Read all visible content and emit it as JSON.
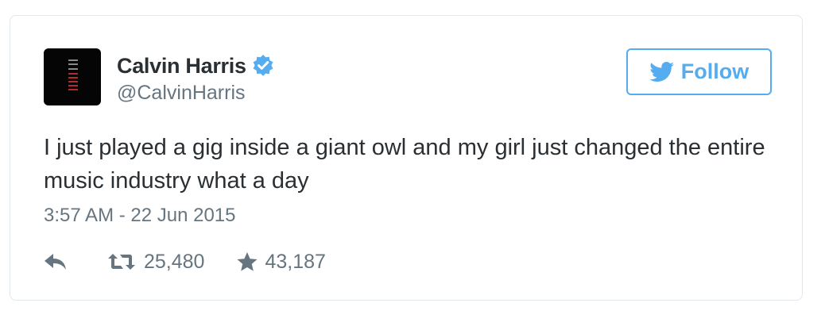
{
  "tweet": {
    "author": {
      "display_name": "Calvin Harris",
      "handle": "@CalvinHarris",
      "verified": true
    },
    "follow_label": "Follow",
    "text": "I just played a gig inside a giant owl and my girl just changed the entire music industry what a day",
    "timestamp": "3:57 AM - 22 Jun 2015",
    "stats": {
      "retweets": "25,480",
      "favorites": "43,187"
    }
  },
  "colors": {
    "accent": "#55acee",
    "text": "#292f33",
    "muted": "#66757f",
    "border": "#e1e8ed"
  },
  "icons": {
    "avatar": "avatar-image",
    "verified": "verified-badge-icon",
    "follow": "twitter-bird-icon",
    "reply": "reply-icon",
    "retweet": "retweet-icon",
    "favorite": "star-icon"
  }
}
